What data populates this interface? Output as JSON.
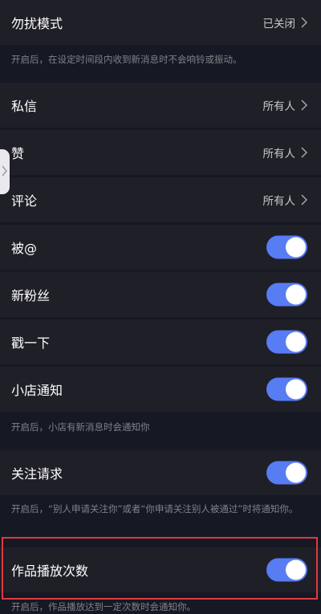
{
  "settings": {
    "dnd": {
      "label": "勿扰模式",
      "value": "已关闭"
    },
    "dnd_note": "开启后，在设定时间段内收到新消息时不会响铃或振动。",
    "dm": {
      "label": "私信",
      "value": "所有人"
    },
    "like": {
      "label": "赞",
      "value": "所有人"
    },
    "comment": {
      "label": "评论",
      "value": "所有人"
    },
    "mentioned": {
      "label": "被@",
      "on": true
    },
    "new_fans": {
      "label": "新粉丝",
      "on": true
    },
    "poke": {
      "label": "戳一下",
      "on": true
    },
    "shop_notice": {
      "label": "小店通知",
      "on": true
    },
    "shop_note": "开启后，小店有新消息时会通知你",
    "follow_request": {
      "label": "关注请求",
      "on": true
    },
    "follow_note": "开启后，“别人申请关注你”或者“你申请关注别人被通过”时将通知你。",
    "play_count": {
      "label": "作品播放次数",
      "on": true
    },
    "play_note": "开启后，作品播放达到一定次数时会通知你。"
  },
  "colors": {
    "toggle_on": "#587cf4",
    "row_bg": "#1f1f28",
    "page_bg": "#161823",
    "highlight": "#e0393e"
  }
}
